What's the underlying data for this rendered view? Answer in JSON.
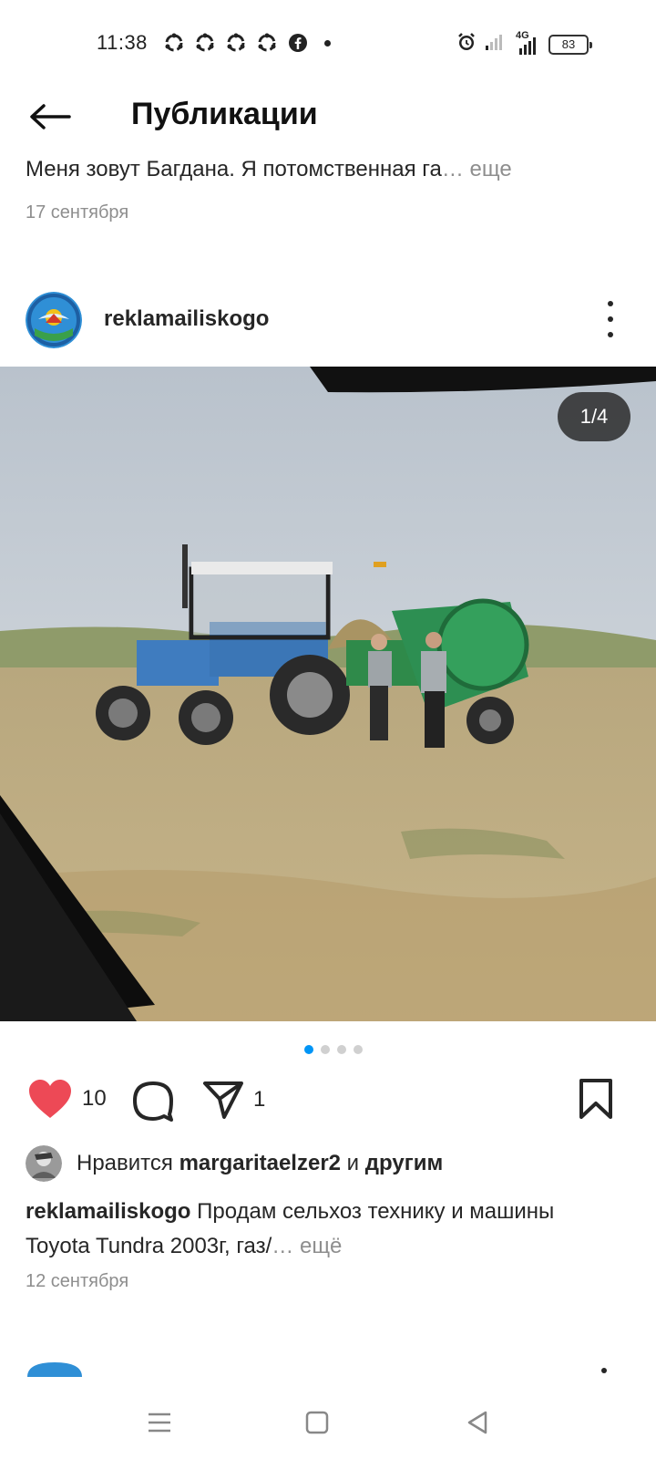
{
  "status_bar": {
    "time": "11:38",
    "network": "4G",
    "battery": "83",
    "notification_icons": [
      "sync-icon",
      "sync-icon",
      "sync-icon",
      "sync-icon",
      "facebook-icon"
    ]
  },
  "header": {
    "title": "Публикации",
    "back_icon": "arrow-left-icon"
  },
  "previous_post": {
    "caption": "Меня зовут Багдана. Я потомственная га",
    "more": "… еще",
    "date": "17 сентября"
  },
  "post": {
    "username": "reklamailiskogo",
    "photo_counter": "1/4",
    "photo_count": 4,
    "current_photo": 1,
    "likes_count": "10",
    "shares_count": "1",
    "liked": true,
    "liked_by": {
      "prefix": "Нравится ",
      "user": "margaritaelzer2",
      "suffix": " и ",
      "others": "другим"
    },
    "caption": {
      "user": "reklamailiskogo",
      "text": " Продам сельхоз технику и машины Toyota Tundra 2003г, газ/",
      "more": "… ещё"
    },
    "date": "12 сентября"
  },
  "colors": {
    "like_red": "#ed4956",
    "accent_blue": "#0095f6",
    "secondary_text": "#8e8e8e"
  },
  "nav_bar": {
    "icons": [
      "menu-icon",
      "home-square-icon",
      "back-triangle-icon"
    ]
  }
}
